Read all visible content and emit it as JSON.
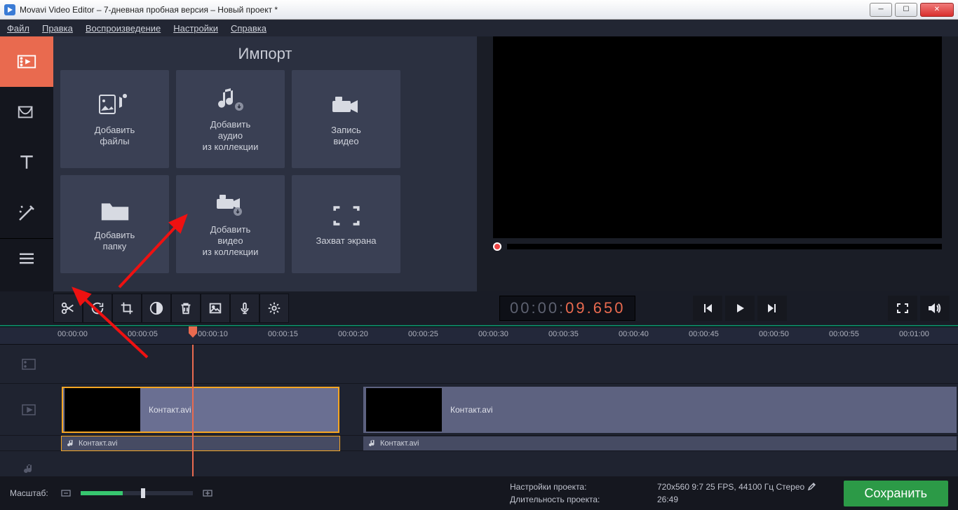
{
  "window": {
    "title": "Movavi Video Editor – 7-дневная пробная версия – Новый проект *"
  },
  "menu": {
    "file": "Файл",
    "edit": "Правка",
    "playback": "Воспроизведение",
    "settings": "Настройки",
    "help": "Справка"
  },
  "import": {
    "title": "Импорт",
    "tiles": {
      "add_files": "Добавить\nфайлы",
      "add_audio": "Добавить\nаудио\nиз коллекции",
      "record_video": "Запись\nвидео",
      "add_folder": "Добавить\nпапку",
      "add_video": "Добавить\nвидео\nиз коллекции",
      "capture": "Захват экрана"
    }
  },
  "timecode": {
    "grey": "00:00:",
    "orange": "09.650"
  },
  "ruler": [
    "00:00:00",
    "00:00:05",
    "00:00:10",
    "00:00:15",
    "00:00:20",
    "00:00:25",
    "00:00:30",
    "00:00:35",
    "00:00:40",
    "00:00:45",
    "00:00:50",
    "00:00:55",
    "00:01:00"
  ],
  "clips": {
    "clip1": "Контакт.avi",
    "clip2": "Контакт.avi",
    "audio1": "Контакт.avi",
    "audio2": "Контакт.avi"
  },
  "footer": {
    "scale_label": "Масштаб:",
    "project_settings_label": "Настройки проекта:",
    "project_settings_value": "720x560 9:7 25 FPS, 44100 Гц Стерео",
    "duration_label": "Длительность проекта:",
    "duration_value": "26:49",
    "save": "Сохранить"
  }
}
